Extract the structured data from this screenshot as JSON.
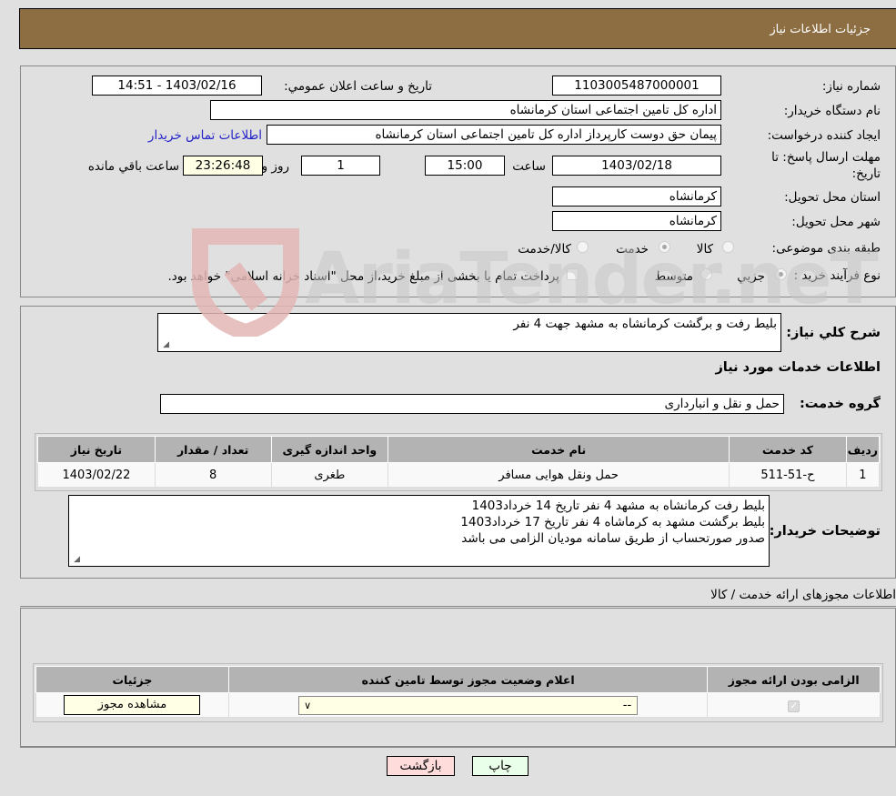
{
  "header": {
    "title": "جزئیات اطلاعات نیاز"
  },
  "info": {
    "need_number_label": "شماره نیاز:",
    "need_number": "1103005487000001",
    "announce_label": "تاریخ و ساعت اعلان عمومي:",
    "announce_value": "1403/02/16 - 14:51",
    "buyer_org_label": "نام دستگاه خریدار:",
    "buyer_org": "اداره کل تامین اجتماعی استان کرمانشاه",
    "creator_label": "ایجاد کننده درخواست:",
    "creator": "پیمان حق دوست کارپرداز اداره کل تامین اجتماعی استان کرمانشاه",
    "contact_link": "اطلاعات تماس خریدار",
    "deadline_label": "مهلت ارسال پاسخ: تا تاریخ:",
    "deadline_date": "1403/02/18",
    "time_label": "ساعت",
    "deadline_time": "15:00",
    "days": "1",
    "days_label": "روز و",
    "remaining_time": "23:26:48",
    "remaining_label": "ساعت باقي مانده",
    "province_label": "استان محل تحویل:",
    "province": "کرمانشاه",
    "city_label": "شهر محل تحویل:",
    "city": "کرمانشاه",
    "category_label": "طبقه بندی موضوعی:",
    "category_options": [
      {
        "label": "کالا",
        "checked": false
      },
      {
        "label": "خدمت",
        "checked": true
      },
      {
        "label": "کالا/خدمت",
        "checked": false
      }
    ],
    "process_label": "نوع فرآیند خرید :",
    "process_options": [
      {
        "label": "جزيي",
        "checked": true
      },
      {
        "label": "متوسط",
        "checked": false
      }
    ],
    "treasury_text": "پرداخت تمام یا بخشی از مبلغ خرید،از محل \"اسناد خزانه اسلامی\" خواهد بود.",
    "treasury_checked": false
  },
  "details": {
    "description_label": "شرح كلي نياز:",
    "description": "بلیط رفت و برگشت کرمانشاه به مشهد جهت 4 نفر",
    "services_title": "اطلاعات خدمات مورد نیاز",
    "service_group_label": "گروه خدمت:",
    "service_group": "حمل و نقل و انبارداری",
    "table": {
      "headers": [
        "ردیف",
        "کد خدمت",
        "نام خدمت",
        "واحد اندازه گیری",
        "تعداد / مقدار",
        "تاریخ نیاز"
      ],
      "rows": [
        [
          "1",
          "ح-51-511",
          "حمل ونقل هوایی مسافر",
          "طغری",
          "8",
          "1403/02/22"
        ]
      ]
    },
    "buyer_notes_label": "توضیحات خریدار:",
    "buyer_notes": [
      "بلیط رفت کرمانشاه به مشهد 4 نفر تاریخ 14 خرداد1403",
      "بلیط برگشت مشهد به کرماشاه 4 نفر تاریخ 17 خرداد1403",
      "صدور صورتحساب از طریق سامانه مودیان الزامی می باشد"
    ]
  },
  "permits": {
    "title": "اطلاعات مجوزهای ارائه خدمت / کالا",
    "headers": [
      "الزامی بودن ارائه مجوز",
      "اعلام وضعیت مجوز توسط تامین کننده",
      "جزئیات"
    ],
    "row": {
      "required_checked": true,
      "status_selected": "--",
      "view_button": "مشاهده مجوز"
    }
  },
  "footer": {
    "print_button": "چاپ",
    "back_button": "بازگشت"
  },
  "watermark": {
    "text": "AriaTender.neT"
  },
  "colors": {
    "header_bg": "#8d6e43",
    "print_bg": "#eaffea",
    "back_bg": "#ffdcdc",
    "link": "#2323c8",
    "remaining_bg": "#ffffe6"
  }
}
